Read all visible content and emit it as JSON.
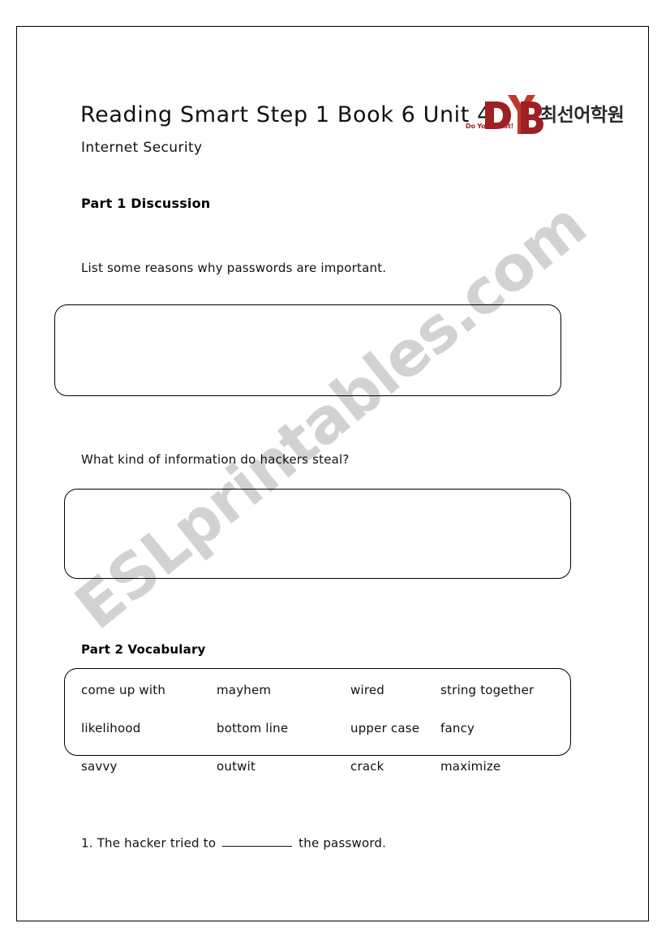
{
  "document": {
    "title": "Reading Smart Step 1 Book 6 Unit 4",
    "subtitle": "Internet Security"
  },
  "logo": {
    "brand": "DYB",
    "korean_name": "최선어학원",
    "tagline": "Do Your Best!",
    "colors": {
      "primary_red": "#9e2022",
      "accent_red": "#c0392b",
      "text_dark": "#2b2b2b"
    }
  },
  "watermark": {
    "text": "ESLprintables.com",
    "color": "#d2d2d2"
  },
  "part1": {
    "heading": "Part 1 Discussion",
    "questions": [
      {
        "prompt": "List some reasons why passwords are important.",
        "answer_value": ""
      },
      {
        "prompt": "What kind of information do hackers steal?",
        "answer_value": ""
      }
    ]
  },
  "part2": {
    "heading": "Part 2 Vocabulary",
    "word_bank": {
      "rows": [
        [
          "come up with",
          "mayhem",
          "wired",
          "string together"
        ],
        [
          "likelihood",
          "bottom line",
          "upper case",
          "fancy"
        ],
        [
          "savvy",
          "outwit",
          "crack",
          "maximize"
        ]
      ],
      "flat": [
        "come up with",
        "mayhem",
        "wired",
        "string together",
        "likelihood",
        "bottom line",
        "upper case",
        "fancy",
        "savvy",
        "outwit",
        "crack",
        "maximize"
      ]
    },
    "exercises": [
      {
        "number": "1.",
        "text_before": "The hacker tried to",
        "blank": "__________",
        "text_after": "the password.",
        "answer_value": ""
      }
    ]
  }
}
